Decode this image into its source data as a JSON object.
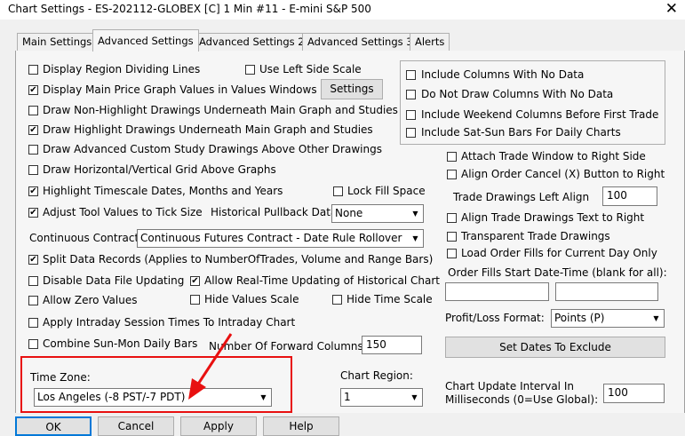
{
  "window": {
    "title": "Chart Settings - ES-202112-GLOBEX [C]  1 Min   #11 - E-mini S&P 500",
    "close_glyph": "✕"
  },
  "tabs": [
    "Main Settings",
    "Advanced Settings",
    "Advanced Settings 2",
    "Advanced Settings 3",
    "Alerts"
  ],
  "left": {
    "display_region_dividing_lines": "Display Region Dividing Lines",
    "use_left_side_scale": "Use Left Side Scale",
    "display_main_price_values": "Display Main Price Graph Values in Values Windows",
    "settings_button": "Settings",
    "draw_non_highlight": "Draw Non-Highlight Drawings Underneath Main Graph and Studies",
    "draw_highlight": "Draw Highlight Drawings Underneath Main Graph and Studies",
    "draw_advanced_custom": "Draw Advanced Custom Study Drawings Above Other Drawings",
    "draw_grid_above": "Draw Horizontal/Vertical Grid Above Graphs",
    "highlight_timescale": "Highlight Timescale Dates, Months and Years",
    "lock_fill_space": "Lock Fill Space",
    "adjust_tool_values": "Adjust Tool Values to Tick Size",
    "historical_pullback_label": "Historical Pullback Data:",
    "historical_pullback_value": "None",
    "continuous_contract_label": "Continuous Contract:",
    "continuous_contract_value": "Continuous Futures Contract - Date Rule Rollover",
    "split_data_records": "Split Data Records (Applies to NumberOfTrades, Volume and Range Bars)",
    "disable_data_file_updating": "Disable Data File Updating",
    "allow_realtime_updating": "Allow Real-Time Updating of Historical Chart",
    "allow_zero_values": "Allow Zero Values",
    "hide_values_scale": "Hide Values Scale",
    "hide_time_scale": "Hide Time Scale",
    "apply_intraday_session": "Apply Intraday Session Times To Intraday Chart",
    "combine_sun_mon": "Combine Sun-Mon Daily Bars",
    "forward_columns_label": "Number Of Forward Columns:",
    "forward_columns_value": "150",
    "time_zone_label": "Time Zone:",
    "time_zone_value": "Los Angeles (-8 PST/-7 PDT)",
    "chart_region_label": "Chart Region:",
    "chart_region_value": "1"
  },
  "right": {
    "include_columns_no_data": "Include Columns With No Data",
    "do_not_draw_columns": "Do Not Draw Columns With No Data",
    "include_weekend_columns": "Include Weekend Columns Before First Trade",
    "include_sat_sun_bars": "Include Sat-Sun Bars For Daily Charts",
    "attach_trade_window": "Attach Trade Window to Right Side",
    "align_order_cancel": "Align Order Cancel (X) Button to Right",
    "trade_drawings_left_align_label": "Trade Drawings Left Align",
    "trade_drawings_left_align_value": "100",
    "align_trade_drawings_text": "Align Trade Drawings Text to Right",
    "transparent_trade_drawings": "Transparent Trade Drawings",
    "load_order_fills": "Load Order Fills for Current Day Only",
    "order_fills_start_label": "Order Fills Start Date-Time (blank for all):",
    "profit_loss_label": "Profit/Loss Format:",
    "profit_loss_value": "Points (P)",
    "set_dates_button": "Set Dates To Exclude",
    "chart_update_interval_label_1": "Chart Update Interval In",
    "chart_update_interval_label_2": "Milliseconds (0=Use Global):",
    "chart_update_interval_value": "100"
  },
  "footer": {
    "ok": "OK",
    "cancel": "Cancel",
    "apply": "Apply",
    "help": "Help"
  },
  "checkmark": "✔",
  "dropdown_arrow": "▼",
  "colors": {
    "annotation_red": "#e81010"
  }
}
